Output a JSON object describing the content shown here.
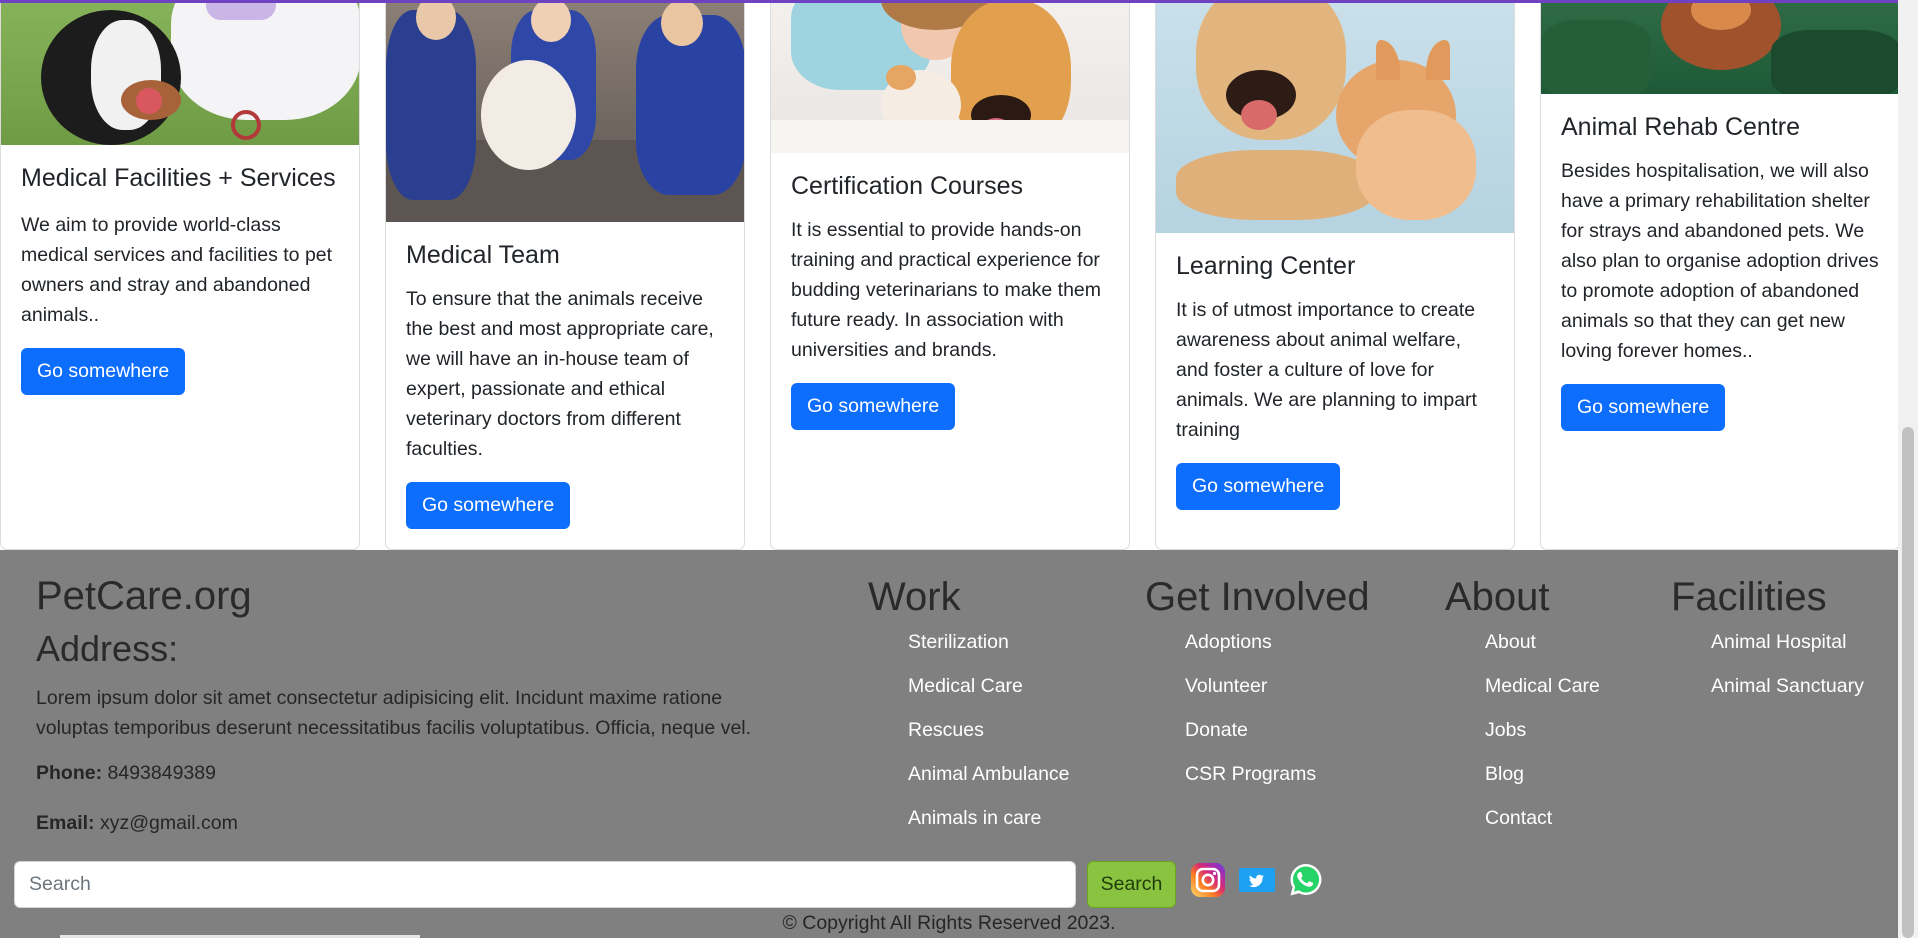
{
  "cards": [
    {
      "title": "Medical Facilities + Services",
      "text": "We aim to provide world-class medical services and facilities to pet owners and stray and abandoned animals..",
      "button": "Go somewhere",
      "image_alt": "Veterinarian hugging a dog"
    },
    {
      "title": "Medical Team",
      "text": "To ensure that the animals receive the best and most appropriate care, we will have an in-house team of expert, passionate and ethical veterinary doctors from different faculties.",
      "button": "Go somewhere",
      "image_alt": "Vet team examining a small white dog"
    },
    {
      "title": "Certification Courses",
      "text": "It is essential to provide hands-on training and practical experience for budding veterinarians to make them future ready. In association with universities and brands.",
      "button": "Go somewhere",
      "image_alt": "Woman with a dog and a kitten"
    },
    {
      "title": "Learning Center",
      "text": "It is of utmost importance to create awareness about animal welfare, and foster a culture of love for animals. We are planning to impart training",
      "button": "Go somewhere",
      "image_alt": "Puppy and kitten lying together"
    },
    {
      "title": "Animal Rehab Centre",
      "text": "Besides hospitalisation, we will also have a primary rehabilitation shelter for strays and abandoned pets. We also plan to organise adoption drives to promote adoption of abandoned animals so that they can get new loving forever homes..",
      "button": "Go somewhere",
      "image_alt": "Person holding a guinea pig"
    }
  ],
  "footer": {
    "brand": "PetCare.org",
    "address_heading": "Address:",
    "address_text": "Lorem ipsum dolor sit amet consectetur adipisicing elit. Incidunt maxime ratione voluptas temporibus deserunt necessitatibus facilis voluptatibus. Officia, neque vel.",
    "phone_label": "Phone:",
    "phone": "8493849389",
    "email_label": "Email:",
    "email": "xyz@gmail.com",
    "columns": [
      {
        "heading": "Work",
        "links": [
          "Sterilization",
          "Medical Care",
          "Rescues",
          "Animal Ambulance",
          "Animals in care"
        ]
      },
      {
        "heading": "Get Involved",
        "links": [
          "Adoptions",
          "Volunteer",
          "Donate",
          "CSR Programs"
        ]
      },
      {
        "heading": "About",
        "links": [
          "About",
          "Medical Care",
          "Jobs",
          "Blog",
          "Contact"
        ]
      },
      {
        "heading": "Facilities",
        "links": [
          "Animal Hospital",
          "Animal Sanctuary"
        ]
      }
    ],
    "search_placeholder": "Search",
    "search_button": "Search",
    "social_icons": [
      "instagram-icon",
      "twitter-icon",
      "whatsapp-icon"
    ],
    "copyright": "© Copyright All Rights Reserved 2023."
  },
  "colors": {
    "primary_button": "#0d6efd",
    "footer_bg": "#808080",
    "search_button": "#8ac33f",
    "top_border": "#6f42c1"
  }
}
